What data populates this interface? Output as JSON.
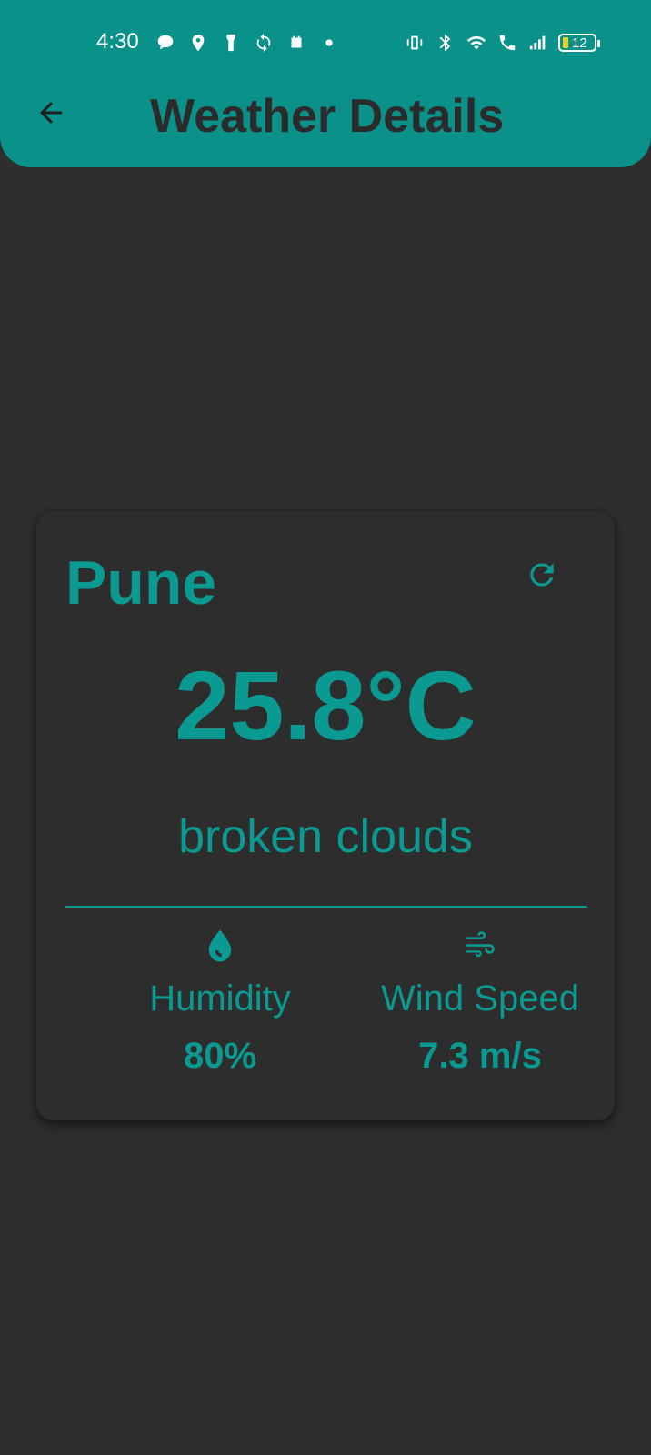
{
  "status_bar": {
    "time": "4:30",
    "battery_level": "12",
    "left_icons": [
      "chat-bubble-icon",
      "location-pin-icon",
      "flashlight-icon",
      "sync-icon",
      "calendar-icon",
      "dot-icon"
    ],
    "right_icons": [
      "vibrate-icon",
      "bluetooth-icon",
      "wifi-icon",
      "wifi-calling-icon",
      "signal-icon"
    ]
  },
  "app_bar": {
    "title": "Weather Details",
    "back_icon": "arrow-back-icon",
    "color": "#0a918a"
  },
  "weather": {
    "city": "Pune",
    "temperature": "25.8°C",
    "description": "broken clouds",
    "refresh_icon": "refresh-icon",
    "humidity": {
      "label": "Humidity",
      "value": "80%",
      "icon": "water-drop-icon"
    },
    "wind": {
      "label": "Wind Speed",
      "value": "7.3 m/s",
      "icon": "wind-icon"
    },
    "accent_color": "#0a9a91",
    "background_color": "#2e2e2e"
  }
}
